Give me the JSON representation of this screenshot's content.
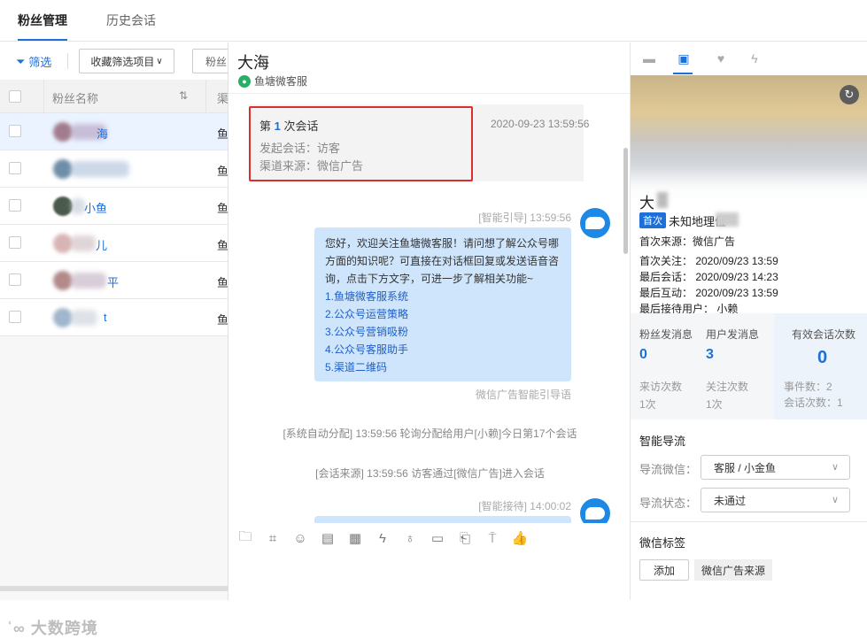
{
  "top_tabs": [
    "粉丝管理",
    "历史会话"
  ],
  "filterbar": {
    "filter_label": "筛选",
    "fav_label": "收藏筛选项目",
    "fans_label": "粉丝"
  },
  "table": {
    "col_name": "粉丝名称",
    "col_channel": "渠",
    "rows": [
      {
        "name_tail": "海",
        "channel": "鱼"
      },
      {
        "name_tail": "",
        "channel": "鱼"
      },
      {
        "name_tail": "小鱼",
        "channel": "鱼"
      },
      {
        "name_tail": "儿",
        "channel": "鱼"
      },
      {
        "name_tail": "平",
        "channel": "鱼"
      },
      {
        "name_tail": "t",
        "channel": "鱼"
      }
    ]
  },
  "watermark": "大数跨境",
  "chat": {
    "title": "大海",
    "source": "鱼塘微客服",
    "session": {
      "prefix": "第",
      "number": "1",
      "suffix": "次会话",
      "initiator": "发起会话：访客",
      "channel": "渠道来源：微信广告",
      "time": "2020-09-23 13:59:56"
    },
    "msg1_meta": "[智能引导] 13:59:56",
    "msg1_text": "您好，欢迎关注鱼塘微客服！请问想了解公众号哪方面的知识呢？可直接在对话框回复或发送语音咨询，点击下方文字，可进一步了解相关功能~",
    "msg1_links": [
      "1.鱼塘微客服系统",
      "2.公众号运营策略",
      "3.公众号营销吸粉",
      "4.公众号客服助手",
      "5.渠道二维码"
    ],
    "msg1_footer": "微信广告智能引导语",
    "sys1": "[系统自动分配] 13:59:56 轮询分配给用户[小赖]今日第17个会话",
    "sys2": "[会话来源] 13:59:56 访客通过[微信广告]进入会话",
    "msg2_meta": "[智能接待] 14:00:02"
  },
  "profile": {
    "name": "大",
    "badge": "首次",
    "location": "未知地理位",
    "first_source": "首次来源：微信广告",
    "first_follow": "首次关注：  2020/09/23 13:59",
    "last_session": "最后会话：  2020/09/23 14:23",
    "last_interact": "最后互动：  2020/09/23 13:59",
    "last_agent": "最后接待用户：  小赖"
  },
  "stats": {
    "fan_msgs_label": "粉丝发消息",
    "fan_msgs": "0",
    "user_msgs_label": "用户发消息",
    "user_msgs": "3",
    "valid_label": "有效会话次数",
    "valid": "0",
    "visits": "来访次数",
    "visits_val": "1次",
    "follows": "关注次数",
    "follows_val": "1次",
    "events": "事件数：2",
    "sessions": "会话次数：1"
  },
  "guide": {
    "title": "智能导流",
    "wechat_label": "导流微信：",
    "wechat_value": "客服 / 小金鱼",
    "status_label": "导流状态：",
    "status_value": "未通过"
  },
  "tags": {
    "title": "微信标签",
    "add": "添加",
    "chip": "微信广告来源"
  },
  "colors": {
    "accent": "#1e6fd9",
    "highlight": "#d9302c",
    "bubble": "#cfe5fb"
  }
}
